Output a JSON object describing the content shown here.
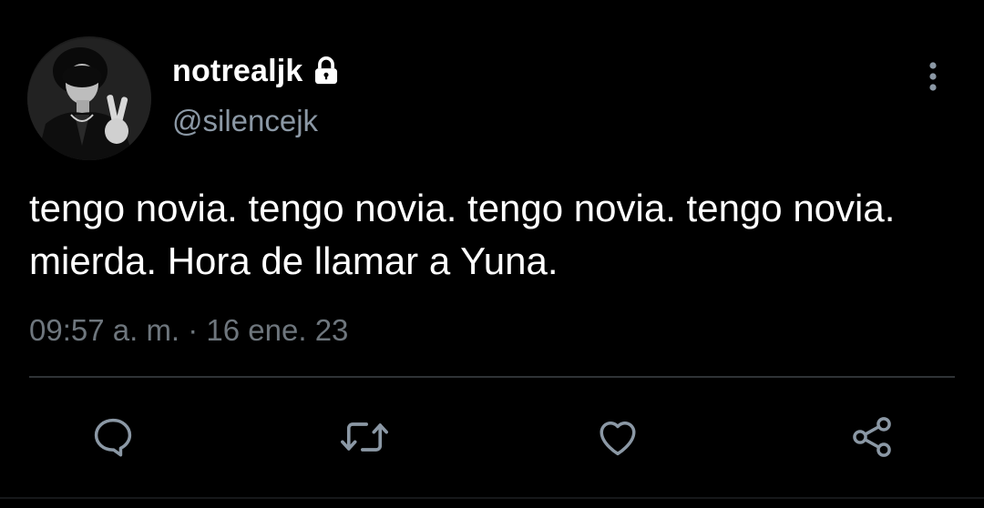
{
  "tweet": {
    "display_name": "notrealjk",
    "handle": "@silencejk",
    "text": "tengo novia. tengo novia. tengo novia. tengo novia. mierda. Hora de llamar a Yuna.",
    "timestamp": "09:57 a. m. · 16 ene. 23",
    "protected_icon": "lock-icon",
    "more_icon": "more-vertical-icon"
  },
  "actions": {
    "reply_icon": "reply-icon",
    "retweet_icon": "retweet-icon",
    "like_icon": "heart-icon",
    "share_icon": "share-icon"
  },
  "colors": {
    "background": "#000000",
    "primary_text": "#ffffff",
    "secondary_text": "#8b98a5",
    "divider": "#2f3336",
    "icon": "#8b98a5"
  }
}
